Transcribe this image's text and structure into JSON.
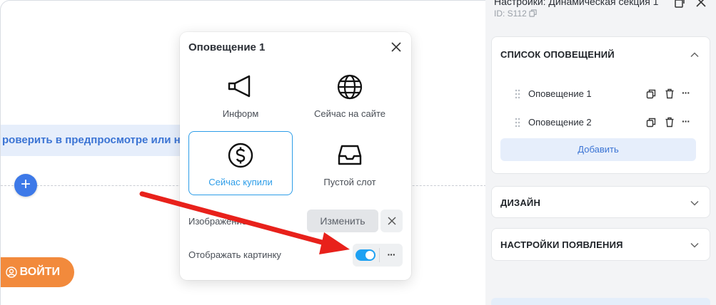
{
  "canvas": {
    "banner_text": "роверить в предпросмотре или на с",
    "add_symbol": "+",
    "login_label": "ВОЙТИ"
  },
  "popup": {
    "title": "Оповещение 1",
    "tiles": [
      {
        "label": "Информ",
        "icon": "megaphone-icon",
        "selected": false
      },
      {
        "label": "Сейчас на сайте",
        "icon": "globe-icon",
        "selected": false
      },
      {
        "label": "Сейчас купили",
        "icon": "dollar-coin-icon",
        "selected": true
      },
      {
        "label": "Пустой слот",
        "icon": "inbox-tray-icon",
        "selected": false
      }
    ],
    "image_label": "Изображение",
    "change_label": "Изменить",
    "show_picture_label": "Отображать картинку",
    "show_picture_enabled": true,
    "more_symbol": "···"
  },
  "panel": {
    "title": "Настройки: Динамическая секция 1",
    "id_text": "ID: S112",
    "sections": [
      {
        "title": "СПИСОК ОПОВЕЩЕНИЙ",
        "expanded": true
      },
      {
        "title": "ДИЗАЙН",
        "expanded": false
      },
      {
        "title": "НАСТРОЙКИ ПОЯВЛЕНИЯ",
        "expanded": false
      }
    ],
    "notifications": [
      {
        "label": "Оповещение 1"
      },
      {
        "label": "Оповещение 2"
      }
    ],
    "add_label": "Добавить",
    "more_symbol": "···"
  },
  "colors": {
    "accent": "#2d9de8",
    "link_blue": "#3b74d4",
    "login_orange": "#f28a3c",
    "arrow_red": "#e8211b",
    "toggle_on": "#1ea1f2"
  }
}
